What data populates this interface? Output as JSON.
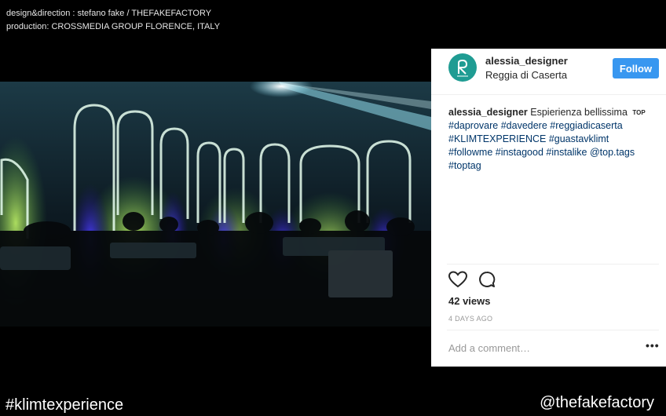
{
  "credits": {
    "line1": "design&direction : stefano fake / THEFAKEFACTORY",
    "line2": "production: CROSSMEDIA GROUP FLORENCE, ITALY"
  },
  "post": {
    "username": "alessia_designer",
    "location": "Reggia di Caserta",
    "follow_label": "Follow",
    "caption_user": "alessia_designer",
    "caption_text": "Espierienza bellissima",
    "caption_icon": "TOP",
    "hashtags_line1": "#daprovare #davedere #reggiadicaserta",
    "hashtags_line2": "#KLIMTEXPERIENCE #guastavklimt",
    "hashtags_line3": "#followme #instagood #instalike @top.tags",
    "hashtags_line4": "#toptag",
    "views": "42 views",
    "time_ago": "4 DAYS AGO",
    "comment_placeholder": "Add a comment…",
    "more_label": "•••"
  },
  "footer": {
    "hashtag": "#klimtexperience",
    "handle": "@thefakefactory"
  },
  "colors": {
    "follow_button": "#3897f0",
    "avatar": "#1f9c93",
    "hashtag_text": "#003569"
  },
  "icons": [
    "heart-icon",
    "comment-bubble-icon",
    "more-options-icon",
    "avatar-logo-icon"
  ]
}
